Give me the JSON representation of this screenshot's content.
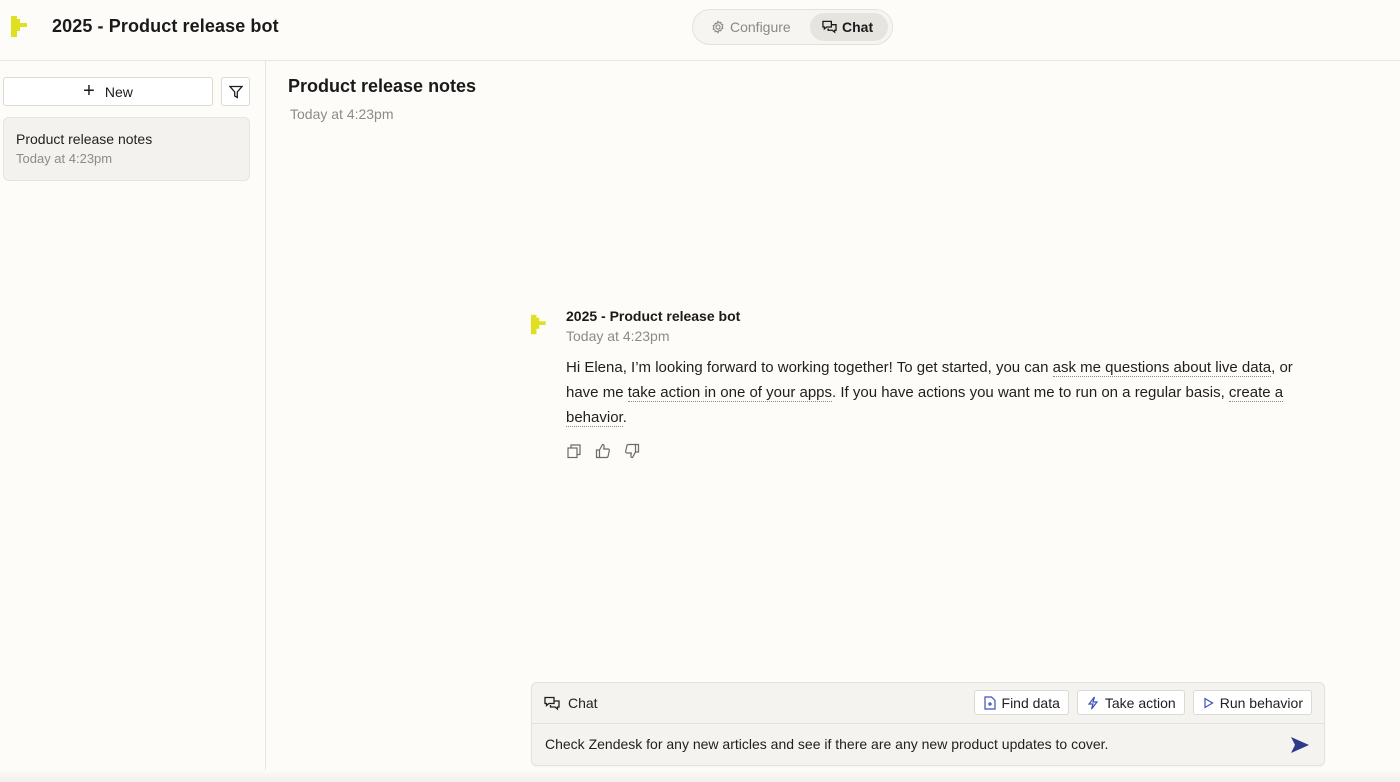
{
  "app": {
    "title": "2025 - Product release bot",
    "logo_icon": "pixel-puzzle-logo",
    "brand_color": "#dfe021"
  },
  "mode_toggle": {
    "options": [
      {
        "label": "Configure",
        "icon": "gear-icon",
        "active": false
      },
      {
        "label": "Chat",
        "icon": "chat-bubbles-icon",
        "active": true
      }
    ]
  },
  "sidebar": {
    "new_button_label": "New",
    "filter_icon": "filter-icon",
    "conversations": [
      {
        "title": "Product release notes",
        "time": "Today at 4:23pm",
        "selected": true
      }
    ]
  },
  "conversation": {
    "title": "Product release notes",
    "time": "Today at 4:23pm"
  },
  "message": {
    "author": "2025 - Product release bot",
    "time": "Today at 4:23pm",
    "segments": {
      "t1": "Hi Elena, I’m looking forward to working together! To get started, you can ",
      "link1": "ask me questions about live data",
      "t2": ", or have me ",
      "link2": "take action in one of your apps",
      "t3": ". If you have actions you want me to run on a regular basis, ",
      "link3": "create a behavior",
      "t4": "."
    },
    "actions": [
      "copy-icon",
      "thumbs-up-icon",
      "thumbs-down-icon"
    ]
  },
  "composer": {
    "label": "Chat",
    "tools": [
      {
        "label": "Find data",
        "icon": "file-search-icon"
      },
      {
        "label": "Take action",
        "icon": "lightning-icon"
      },
      {
        "label": "Run behavior",
        "icon": "play-icon"
      }
    ],
    "input_value": "Check Zendesk for any new articles and see if there are any new product updates to cover.",
    "send_icon": "send-icon",
    "accent_color": "#2d3a8c"
  }
}
